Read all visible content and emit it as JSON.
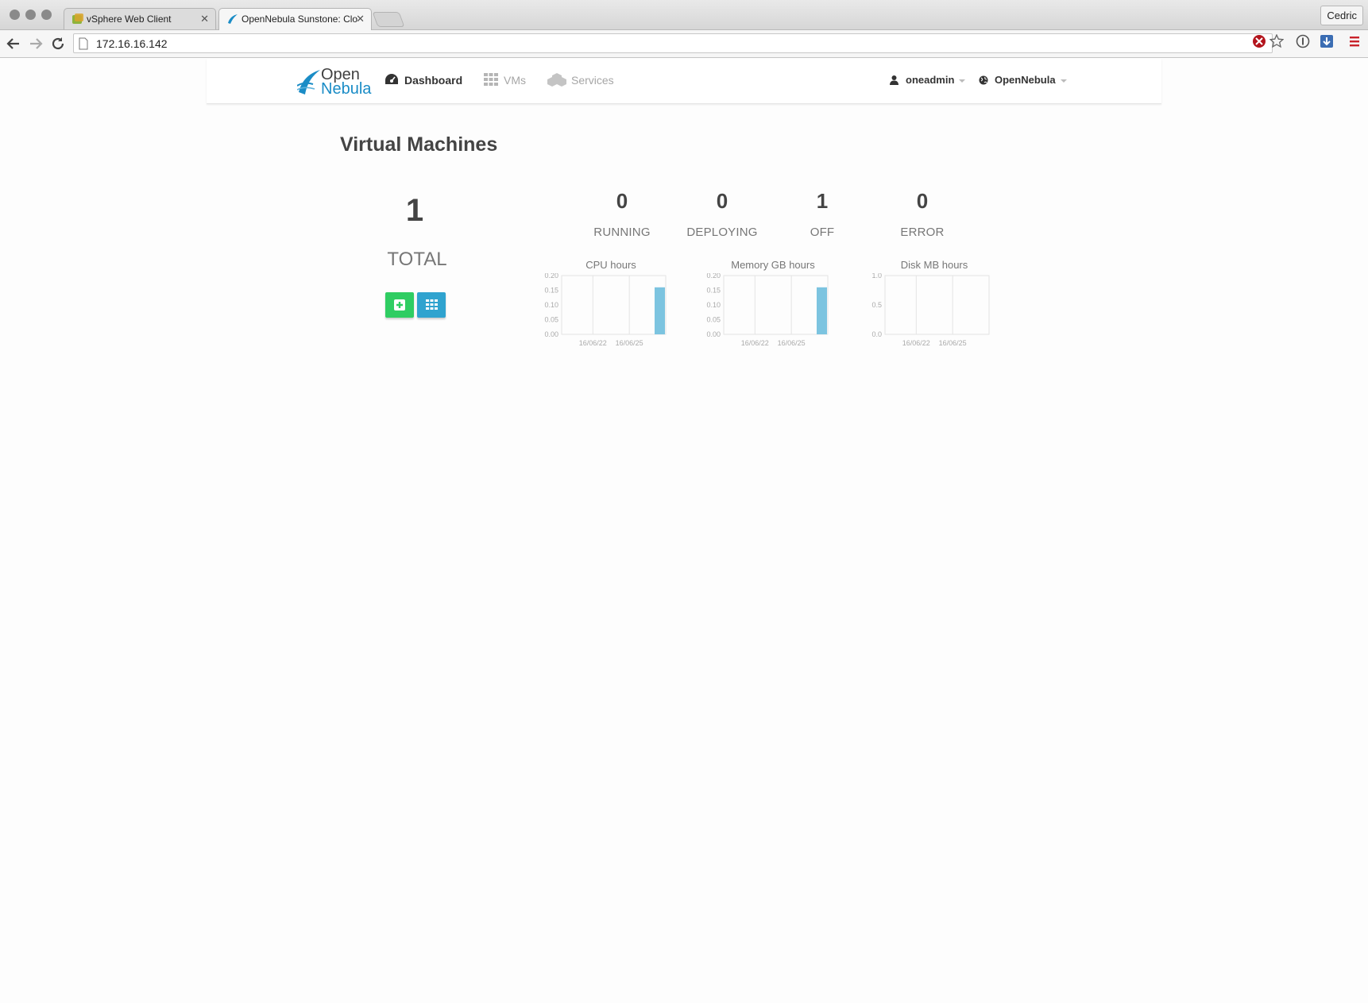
{
  "browser": {
    "tabs": [
      {
        "title": "vSphere Web Client",
        "active": false
      },
      {
        "title": "OpenNebula Sunstone: Clo",
        "active": true
      }
    ],
    "profile_name": "Cedric",
    "url": "172.16.16.142"
  },
  "header": {
    "logo_line1": "Open",
    "logo_line2": "Nebula",
    "nav": [
      {
        "label": "Dashboard",
        "active": true,
        "icon": "dashboard-icon"
      },
      {
        "label": "VMs",
        "active": false,
        "icon": "grid-icon"
      },
      {
        "label": "Services",
        "active": false,
        "icon": "cubes-icon"
      }
    ],
    "user": "oneadmin",
    "zone": "OpenNebula"
  },
  "main": {
    "title": "Virtual Machines",
    "total": {
      "value": "1",
      "label": "TOTAL"
    },
    "stats": [
      {
        "value": "0",
        "label": "RUNNING"
      },
      {
        "value": "0",
        "label": "DEPLOYING"
      },
      {
        "value": "1",
        "label": "OFF"
      },
      {
        "value": "0",
        "label": "ERROR"
      }
    ],
    "buttons": {
      "create_icon": "plus-square-icon",
      "list_icon": "grid-icon"
    }
  },
  "colors": {
    "accent": "#1a8cc6",
    "create_button": "#2fcd62",
    "list_button": "#2fa3cf",
    "bar": "#7cc4e0"
  },
  "chart_data": [
    {
      "type": "bar",
      "title": "CPU hours",
      "yticks": [
        "0.20",
        "0.15",
        "0.10",
        "0.05",
        "0.00"
      ],
      "ylim": [
        0,
        0.2
      ],
      "xticks": [
        "16/06/22",
        "16/06/25"
      ],
      "series": [
        {
          "values": [
            0,
            0,
            0,
            0.16
          ]
        }
      ]
    },
    {
      "type": "bar",
      "title": "Memory GB hours",
      "yticks": [
        "0.20",
        "0.15",
        "0.10",
        "0.05",
        "0.00"
      ],
      "ylim": [
        0,
        0.2
      ],
      "xticks": [
        "16/06/22",
        "16/06/25"
      ],
      "series": [
        {
          "values": [
            0,
            0,
            0,
            0.16
          ]
        }
      ]
    },
    {
      "type": "bar",
      "title": "Disk MB hours",
      "yticks": [
        "1.0",
        "0.5",
        "0.0"
      ],
      "ylim": [
        0,
        1
      ],
      "xticks": [
        "16/06/22",
        "16/06/25"
      ],
      "series": [
        {
          "values": [
            0,
            0,
            0,
            0
          ]
        }
      ]
    }
  ]
}
